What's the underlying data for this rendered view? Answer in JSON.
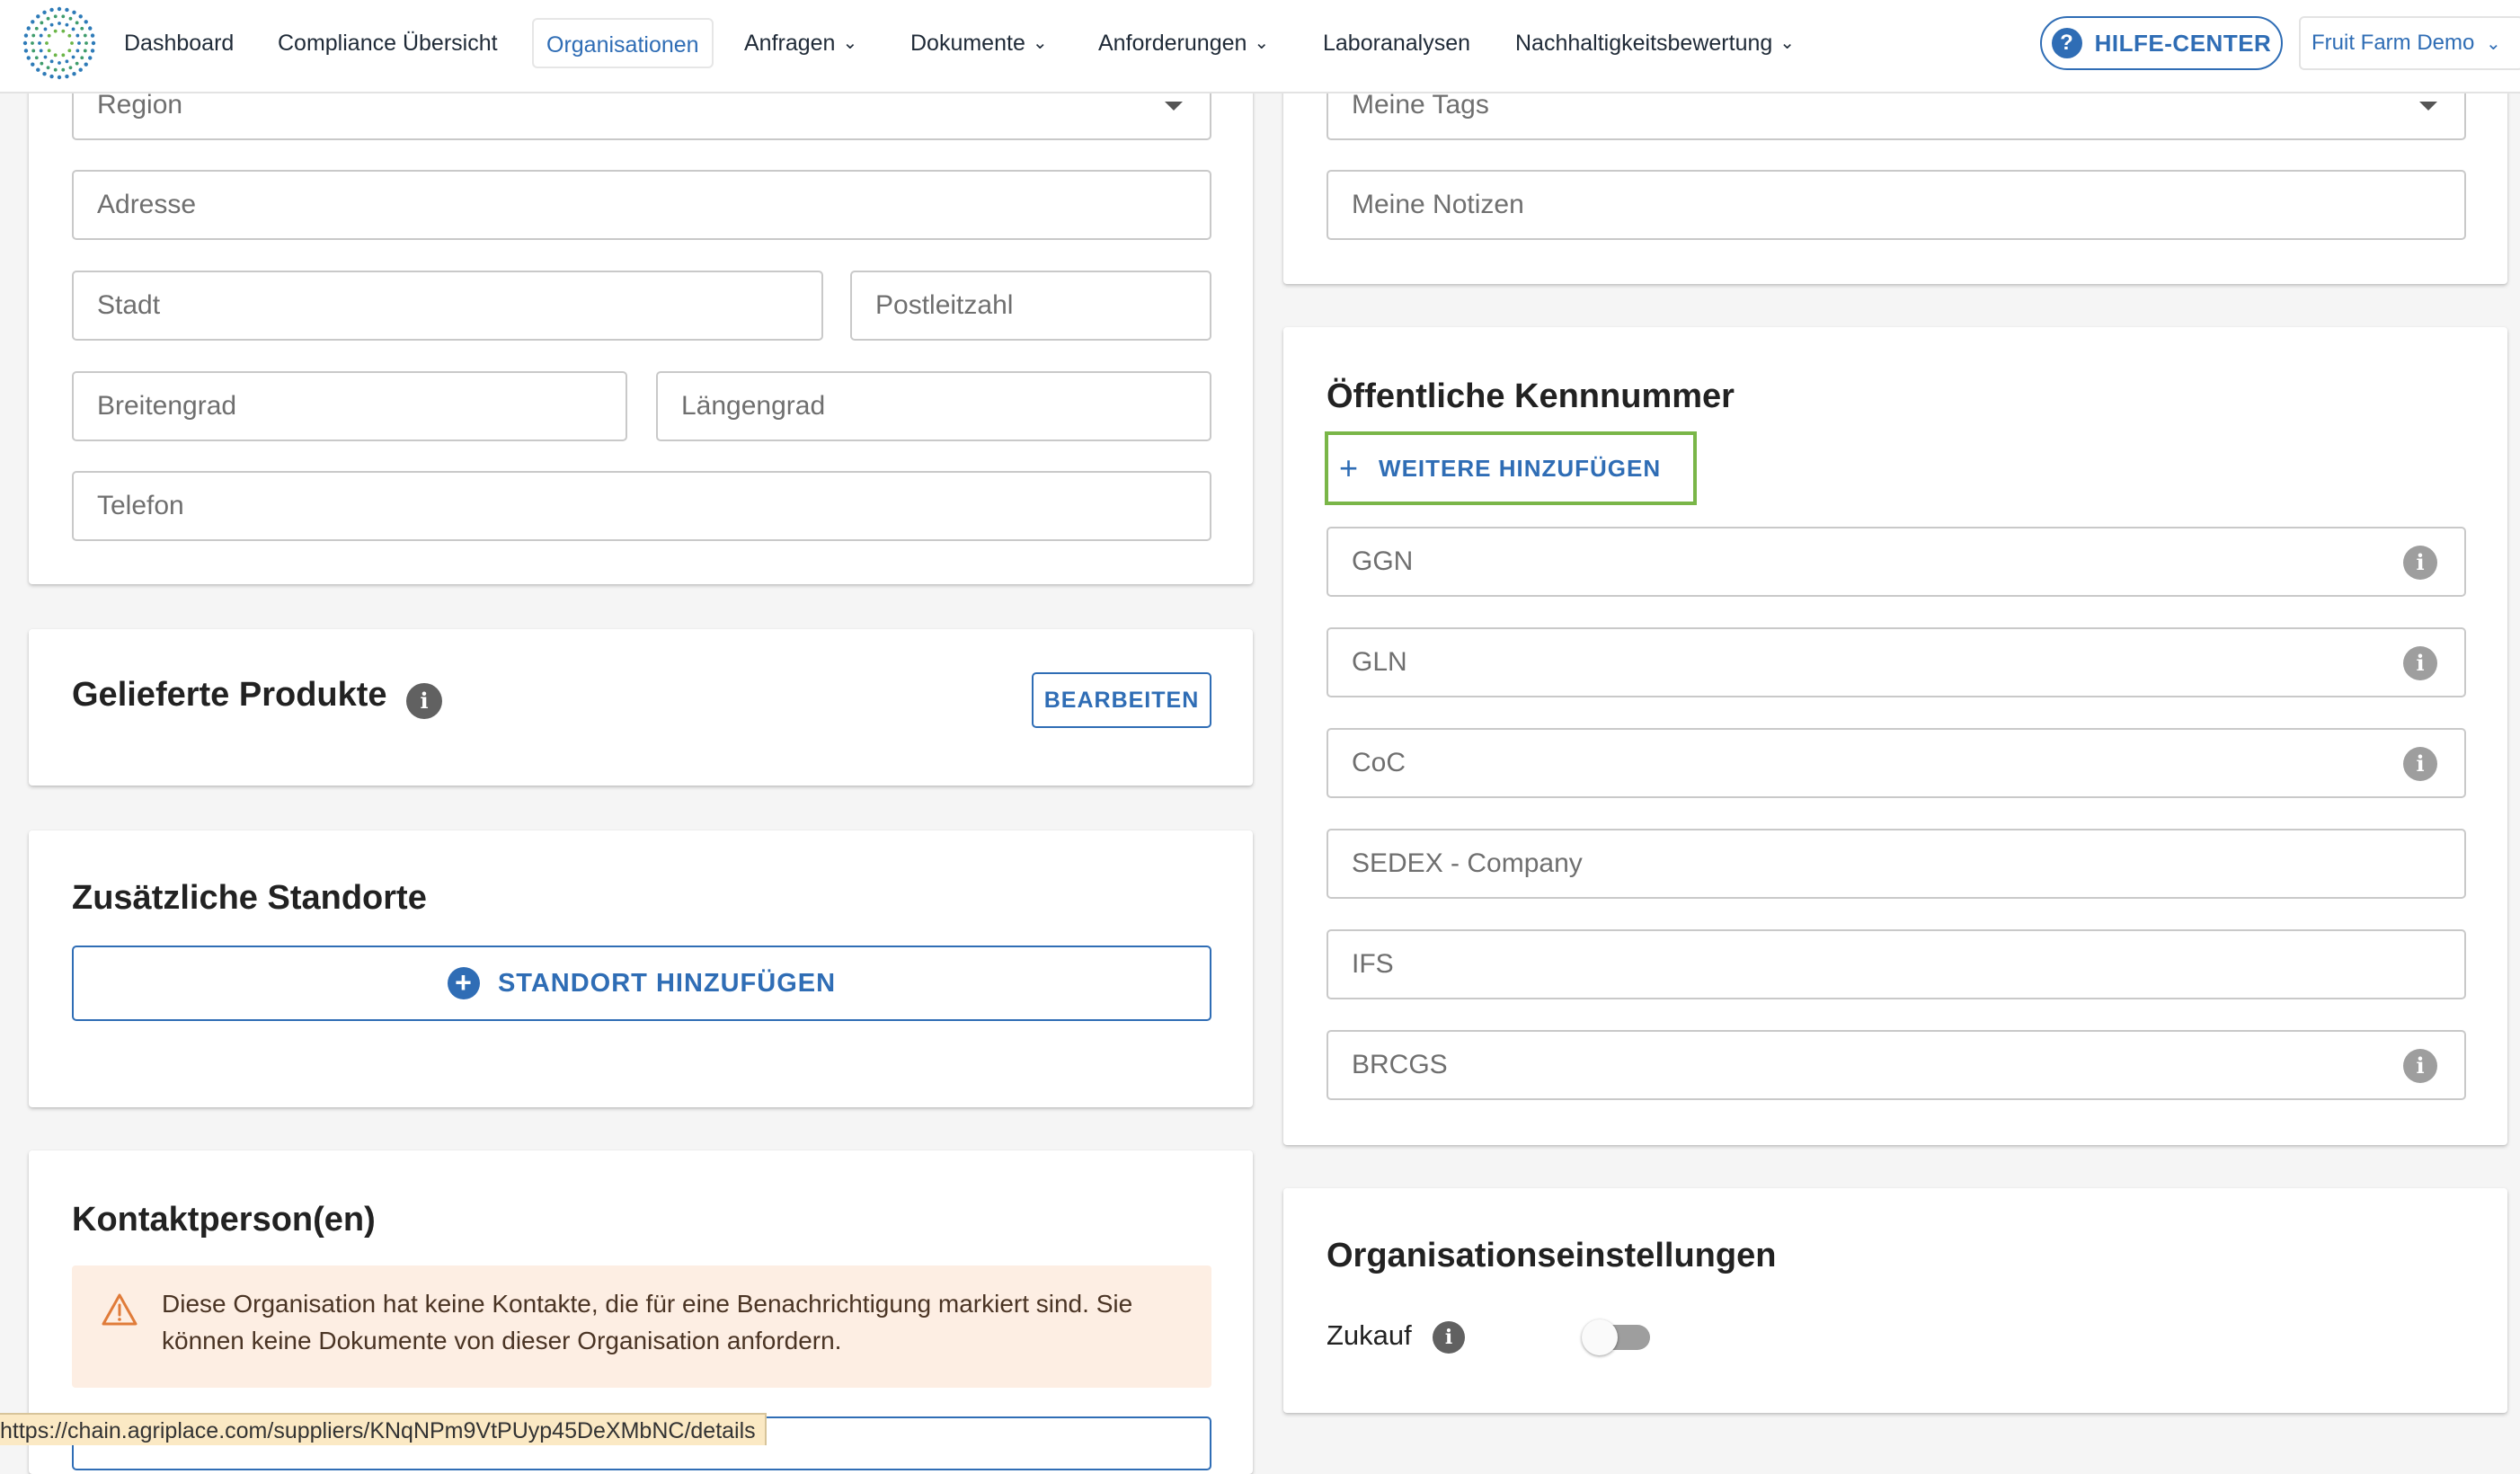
{
  "nav": {
    "items": [
      {
        "label": "Dashboard"
      },
      {
        "label": "Compliance Übersicht"
      },
      {
        "label": "Organisationen"
      },
      {
        "label": "Anfragen"
      },
      {
        "label": "Dokumente"
      },
      {
        "label": "Anforderungen"
      },
      {
        "label": "Laboranalysen"
      },
      {
        "label": "Nachhaltigkeitsbewertung"
      }
    ],
    "active": "Organisationen",
    "help_label": "HILFE-CENTER",
    "help_icon": "?",
    "org_selector": "Fruit Farm Demo"
  },
  "address_card": {
    "region_placeholder": "Region",
    "address_placeholder": "Adresse",
    "city_placeholder": "Stadt",
    "zip_placeholder": "Postleitzahl",
    "lat_placeholder": "Breitengrad",
    "lng_placeholder": "Längengrad",
    "phone_placeholder": "Telefon"
  },
  "tags_card": {
    "tags_placeholder": "Meine Tags",
    "notes_placeholder": "Meine Notizen"
  },
  "products_card": {
    "title": "Gelieferte Produkte",
    "edit_label": "BEARBEITEN"
  },
  "locations_card": {
    "title": "Zusätzliche Standorte",
    "add_label": "STANDORT HINZUFÜGEN"
  },
  "contacts_card": {
    "title": "Kontaktperson(en)",
    "warning": "Diese Organisation hat keine Kontakte, die für eine Benachrichtigung markiert sind. Sie können keine Dokumente von dieser Organisation anfordern."
  },
  "ids_card": {
    "title": "Öffentliche Kennnummer",
    "add_more_label": "WEITERE HINZUFÜGEN",
    "fields": [
      {
        "label": "GGN",
        "info": true
      },
      {
        "label": "GLN",
        "info": true
      },
      {
        "label": "CoC",
        "info": true
      },
      {
        "label": "SEDEX - Company",
        "info": false
      },
      {
        "label": "IFS",
        "info": false
      },
      {
        "label": "BRCGS",
        "info": true
      }
    ]
  },
  "settings_card": {
    "title": "Organisationseinstellungen",
    "zukauf_label": "Zukauf",
    "zukauf_enabled": false
  },
  "status_url": "https://chain.agriplace.com/suppliers/KNqNPm9VtPUyp45DeXMbNC/details",
  "colors": {
    "accent": "#2f6db5",
    "highlight": "#7ab648",
    "warning_bg": "#fdeee3",
    "warning_icon": "#e07b39"
  }
}
